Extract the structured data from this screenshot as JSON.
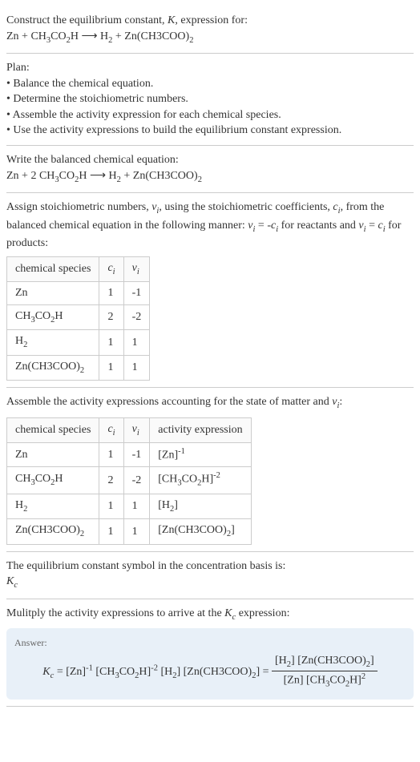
{
  "intro": {
    "title": "Construct the equilibrium constant, K, expression for:",
    "equation": "Zn + CH₃CO₂H ⟶ H₂ + Zn(CH3COO)₂"
  },
  "plan": {
    "heading": "Plan:",
    "items": [
      "• Balance the chemical equation.",
      "• Determine the stoichiometric numbers.",
      "• Assemble the activity expression for each chemical species.",
      "• Use the activity expressions to build the equilibrium constant expression."
    ]
  },
  "balanced": {
    "heading": "Write the balanced chemical equation:",
    "equation": "Zn + 2 CH₃CO₂H ⟶ H₂ + Zn(CH3COO)₂"
  },
  "stoich": {
    "intro_part1": "Assign stoichiometric numbers, ",
    "intro_nu": "νᵢ",
    "intro_part2": ", using the stoichiometric coefficients, ",
    "intro_c": "cᵢ",
    "intro_part3": ", from the balanced chemical equation in the following manner: ",
    "intro_eq1": "νᵢ = -cᵢ",
    "intro_part4": " for reactants and ",
    "intro_eq2": "νᵢ = cᵢ",
    "intro_part5": " for products:",
    "headers": [
      "chemical species",
      "cᵢ",
      "νᵢ"
    ],
    "rows": [
      {
        "species": "Zn",
        "c": "1",
        "nu": "-1"
      },
      {
        "species": "CH₃CO₂H",
        "c": "2",
        "nu": "-2"
      },
      {
        "species": "H₂",
        "c": "1",
        "nu": "1"
      },
      {
        "species": "Zn(CH3COO)₂",
        "c": "1",
        "nu": "1"
      }
    ]
  },
  "activity": {
    "intro": "Assemble the activity expressions accounting for the state of matter and νᵢ:",
    "headers": [
      "chemical species",
      "cᵢ",
      "νᵢ",
      "activity expression"
    ],
    "rows": [
      {
        "species": "Zn",
        "c": "1",
        "nu": "-1",
        "expr": "[Zn]⁻¹"
      },
      {
        "species": "CH₃CO₂H",
        "c": "2",
        "nu": "-2",
        "expr": "[CH₃CO₂H]⁻²"
      },
      {
        "species": "H₂",
        "c": "1",
        "nu": "1",
        "expr": "[H₂]"
      },
      {
        "species": "Zn(CH3COO)₂",
        "c": "1",
        "nu": "1",
        "expr": "[Zn(CH3COO)₂]"
      }
    ]
  },
  "symbol": {
    "text": "The equilibrium constant symbol in the concentration basis is:",
    "kc": "K_c"
  },
  "multiply": {
    "text": "Mulitply the activity expressions to arrive at the K_c expression:"
  },
  "answer": {
    "label": "Answer:",
    "kc": "K_c",
    "lhs": " = [Zn]⁻¹ [CH₃CO₂H]⁻² [H₂] [Zn(CH3COO)₂] = ",
    "num": "[H₂] [Zn(CH3COO)₂]",
    "den": "[Zn] [CH₃CO₂H]²"
  }
}
